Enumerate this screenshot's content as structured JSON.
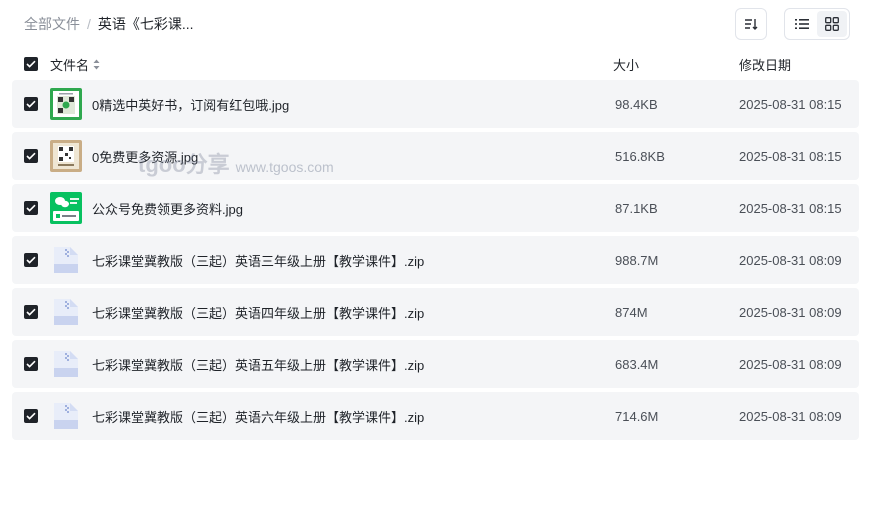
{
  "breadcrumb": {
    "root": "全部文件",
    "separator": "/",
    "current": "英语《七彩课..."
  },
  "toolbar": {
    "sort_icon": "sort-icon",
    "list_view_icon": "list-view-icon",
    "grid_view_icon": "grid-view-icon",
    "active_view": "grid"
  },
  "header": {
    "name": "文件名",
    "size": "大小",
    "date": "修改日期"
  },
  "files": [
    {
      "name": "0精选中英好书，订阅有红包哦.jpg",
      "size": "98.4KB",
      "date": "2025-08-31 08:15",
      "thumb": "qr-green",
      "checked": true
    },
    {
      "name": "0免费更多资源.jpg",
      "size": "516.8KB",
      "date": "2025-08-31 08:15",
      "thumb": "qr-beige",
      "checked": true
    },
    {
      "name": "公众号免费领更多资料.jpg",
      "size": "87.1KB",
      "date": "2025-08-31 08:15",
      "thumb": "wechat",
      "checked": true
    },
    {
      "name": "七彩课堂冀教版（三起）英语三年级上册【教学课件】.zip",
      "size": "988.7M",
      "date": "2025-08-31 08:09",
      "thumb": "zip",
      "checked": true
    },
    {
      "name": "七彩课堂冀教版（三起）英语四年级上册【教学课件】.zip",
      "size": "874M",
      "date": "2025-08-31 08:09",
      "thumb": "zip",
      "checked": true
    },
    {
      "name": "七彩课堂冀教版（三起）英语五年级上册【教学课件】.zip",
      "size": "683.4M",
      "date": "2025-08-31 08:09",
      "thumb": "zip",
      "checked": true
    },
    {
      "name": "七彩课堂冀教版（三起）英语六年级上册【教学课件】.zip",
      "size": "714.6M",
      "date": "2025-08-31 08:09",
      "thumb": "zip",
      "checked": true
    }
  ],
  "watermark": {
    "logo": "tgoo分享",
    "url": "www.tgoos.com"
  },
  "colors": {
    "row_bg": "#f4f5f7",
    "checkbox": "#1f2329",
    "wechat_green": "#07c160",
    "zip_blue": "#c9d3ef"
  }
}
